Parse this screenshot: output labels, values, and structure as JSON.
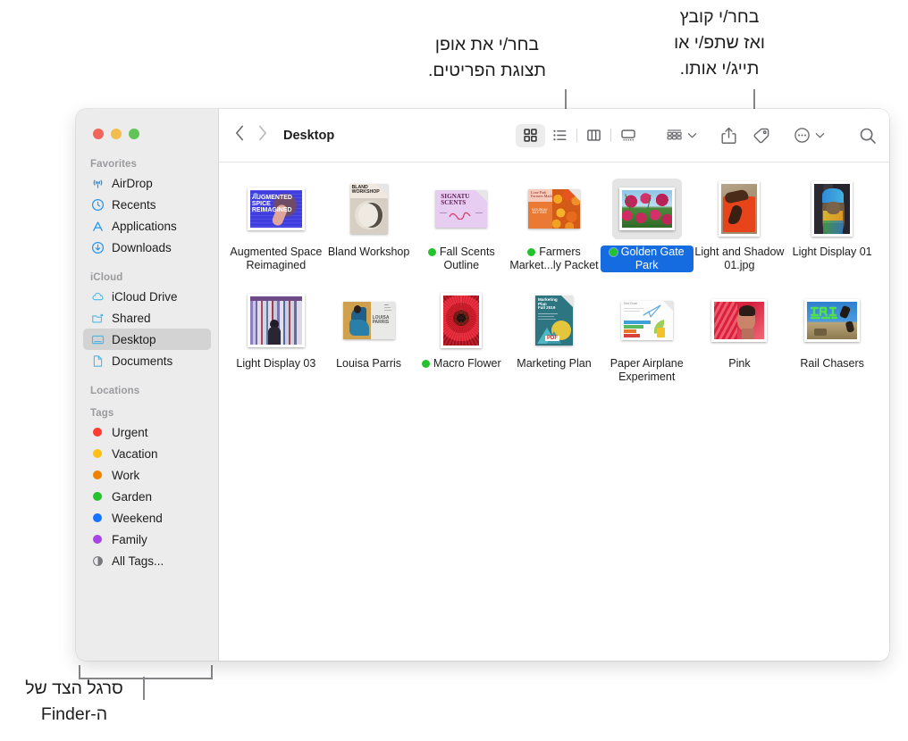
{
  "annotations": {
    "top_left": {
      "text": "בחר/י את אופן\nתצוגת הפריטים.",
      "name": "callout-view-options"
    },
    "top_right": {
      "text": "בחר/י קובץ\nואז שתפ/י או\nתייג/י אותו.",
      "name": "callout-share-tag"
    },
    "bottom": {
      "text": "סרגל הצד של\nה-Finder",
      "name": "callout-sidebar"
    }
  },
  "window": {
    "traffic_lights": [
      "close",
      "minimize",
      "zoom"
    ],
    "traffic_colors": {
      "close": "#f0655c",
      "minimize": "#f2bd4e",
      "zoom": "#61c555"
    }
  },
  "sidebar": {
    "groups": [
      {
        "title": "Favorites",
        "items": [
          {
            "label": "AirDrop",
            "icon": "airdrop-icon",
            "selected": false
          },
          {
            "label": "Recents",
            "icon": "clock-icon",
            "selected": false
          },
          {
            "label": "Applications",
            "icon": "applications-icon",
            "selected": false
          },
          {
            "label": "Downloads",
            "icon": "downloads-icon",
            "selected": false
          }
        ]
      },
      {
        "title": "iCloud",
        "items": [
          {
            "label": "iCloud Drive",
            "icon": "cloud-icon",
            "selected": false
          },
          {
            "label": "Shared",
            "icon": "shared-folder-icon",
            "selected": false
          },
          {
            "label": "Desktop",
            "icon": "desktop-icon",
            "selected": true
          },
          {
            "label": "Documents",
            "icon": "document-icon",
            "selected": false
          }
        ]
      },
      {
        "title": "Locations",
        "items": []
      },
      {
        "title": "Tags",
        "items": [
          {
            "label": "Urgent",
            "icon": "tag-dot",
            "color": "#ff3a30",
            "selected": false
          },
          {
            "label": "Vacation",
            "icon": "tag-dot",
            "color": "#fcc014",
            "selected": false
          },
          {
            "label": "Work",
            "icon": "tag-dot",
            "color": "#ef8100",
            "selected": false
          },
          {
            "label": "Garden",
            "icon": "tag-dot",
            "color": "#24c22e",
            "selected": false
          },
          {
            "label": "Weekend",
            "icon": "tag-dot",
            "color": "#1574ff",
            "selected": false
          },
          {
            "label": "Family",
            "icon": "tag-dot",
            "color": "#a845e8",
            "selected": false
          },
          {
            "label": "All Tags...",
            "icon": "all-tags-icon",
            "selected": false
          }
        ]
      }
    ]
  },
  "toolbar": {
    "back_label": "‹",
    "forward_label": "›",
    "breadcrumb": "Desktop",
    "view_modes": [
      {
        "name": "icon-view",
        "active": true
      },
      {
        "name": "list-view",
        "active": false
      },
      {
        "name": "column-view",
        "active": false
      },
      {
        "name": "gallery-view",
        "active": false
      }
    ],
    "actions": [
      {
        "name": "group-by-button",
        "has_chevron": true
      },
      {
        "name": "share-button",
        "has_chevron": false
      },
      {
        "name": "tag-button",
        "has_chevron": false
      },
      {
        "name": "more-actions-button",
        "has_chevron": true
      },
      {
        "name": "search-button",
        "has_chevron": false
      }
    ]
  },
  "files": [
    {
      "name": "Augmented Space Reimagined",
      "kind": "poster-blue",
      "tag_color": null,
      "selected": false
    },
    {
      "name": "Bland Workshop",
      "kind": "doc-bland",
      "tag_color": null,
      "selected": false
    },
    {
      "name": "Fall Scents Outline",
      "kind": "doc-scents",
      "tag_color": "#24c22e",
      "selected": false
    },
    {
      "name": "Farmers Market...ly Packet",
      "kind": "doc-farmers",
      "tag_color": "#24c22e",
      "selected": false
    },
    {
      "name": "Golden Gate Park",
      "kind": "photo-flowers",
      "tag_color": "#24c22e",
      "selected": true
    },
    {
      "name": "Light and Shadow 01.jpg",
      "kind": "photo-shadow",
      "tag_color": null,
      "selected": false
    },
    {
      "name": "Light Display 01",
      "kind": "photo-portrait",
      "tag_color": null,
      "selected": false
    },
    {
      "name": "Light Display 03",
      "kind": "photo-stripes",
      "tag_color": null,
      "selected": false
    },
    {
      "name": "Louisa Parris",
      "kind": "doc-louisa",
      "tag_color": null,
      "selected": false
    },
    {
      "name": "Macro Flower",
      "kind": "photo-macro",
      "tag_color": "#24c22e",
      "selected": false
    },
    {
      "name": "Marketing Plan",
      "kind": "pdf-marketing",
      "tag_color": null,
      "selected": false
    },
    {
      "name": "Paper Airplane Experiment",
      "kind": "doc-airplane",
      "tag_color": null,
      "selected": false
    },
    {
      "name": "Pink",
      "kind": "photo-pink",
      "tag_color": null,
      "selected": false
    },
    {
      "name": "Rail Chasers",
      "kind": "photo-rail",
      "tag_color": null,
      "selected": false
    }
  ]
}
